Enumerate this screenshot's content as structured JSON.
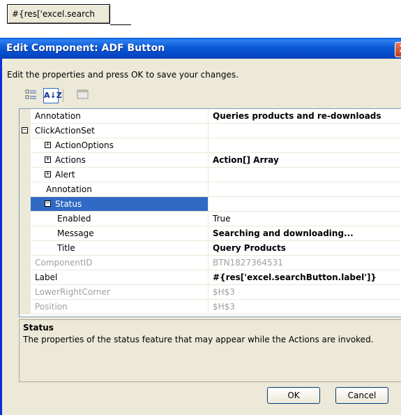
{
  "cell_button_text": "#{res['excel.search",
  "dialog": {
    "title": "Edit Component: ADF Button",
    "close_glyph": "X",
    "instructions": "Edit the properties and press OK to save your changes.",
    "toolbar": {
      "categorized_icon": "categorized-icon",
      "alphabetical_label": "A↓Z",
      "property_pages_icon": "property-pages-icon"
    },
    "properties": [
      {
        "name": "Annotation",
        "value": "Queries products and re-downloads",
        "value_bold": true
      },
      {
        "name": "ClickActionSet",
        "value": "",
        "expander": "minus",
        "gutter_expander": true
      },
      {
        "name": "ActionOptions",
        "value": "",
        "expander": "plus"
      },
      {
        "name": "Actions",
        "value": "Action[] Array",
        "expander": "plus",
        "value_bold": true
      },
      {
        "name": "Alert",
        "value": "",
        "expander": "plus"
      },
      {
        "name": "Annotation",
        "value": ""
      },
      {
        "name": "Status",
        "value": "",
        "expander": "minus",
        "selected": true
      },
      {
        "name": "Enabled",
        "value": "True"
      },
      {
        "name": "Message",
        "value": "Searching and downloading...",
        "value_bold": true
      },
      {
        "name": "Title",
        "value": "Query Products",
        "value_bold": true
      },
      {
        "name": "ComponentID",
        "value": "BTN1827364531",
        "disabled": true
      },
      {
        "name": "Label",
        "value": "#{res['excel.searchButton.label']}",
        "value_bold": true
      },
      {
        "name": "LowerRightCorner",
        "value": "$H$3",
        "disabled": true,
        "gutter_expander": true
      },
      {
        "name": "Position",
        "value": "$H$3",
        "disabled": true,
        "gutter_expander": true
      }
    ],
    "description": {
      "title": "Status",
      "text": "The properties of the status feature that may appear while the Actions are invoked."
    },
    "ok_label": "OK",
    "cancel_label": "Cancel"
  }
}
